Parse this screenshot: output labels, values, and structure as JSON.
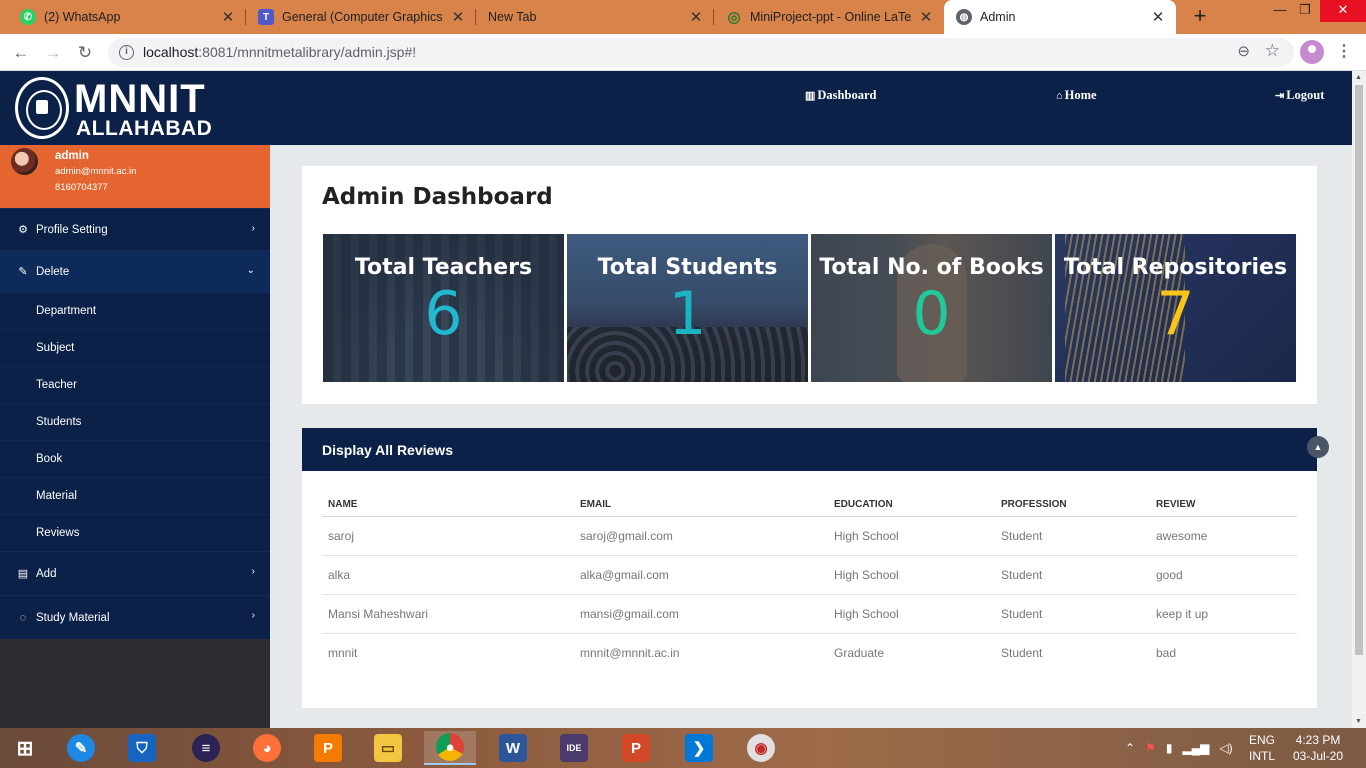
{
  "browser": {
    "tabs": [
      {
        "label": "(2) WhatsApp",
        "icon": "whatsapp-icon",
        "color": "#25d366",
        "glyph": "✆"
      },
      {
        "label": "General (Computer Graphics (CS",
        "icon": "teams-icon",
        "color": "#5059c9",
        "glyph": "T"
      },
      {
        "label": "New Tab",
        "icon": "",
        "color": "",
        "glyph": ""
      },
      {
        "label": "MiniProject-ppt - Online LaTeX",
        "icon": "overleaf-icon",
        "color": "#4f9c45",
        "glyph": "◎"
      },
      {
        "label": "Admin",
        "icon": "globe-icon",
        "color": "#5f6368",
        "glyph": "◍"
      }
    ],
    "url_host": "localhost",
    "url_rest": ":8081/mnnitmetalibrary/admin.jsp#!"
  },
  "header": {
    "logo_line1": "MNNIT",
    "logo_line2": "ALLAHABAD",
    "nav": {
      "dashboard": "Dashboard",
      "home": "Home",
      "logout": "Logout"
    }
  },
  "user": {
    "name": "admin",
    "email": "admin@mnnit.ac.in",
    "phone": "8160704377"
  },
  "sidebar": {
    "profile_setting": "Profile Setting",
    "delete": "Delete",
    "delete_items": [
      "Department",
      "Subject",
      "Teacher",
      "Students",
      "Book",
      "Material",
      "Reviews"
    ],
    "add": "Add",
    "study_material": "Study Material"
  },
  "dashboard": {
    "title": "Admin Dashboard",
    "cards": [
      {
        "label": "Total Teachers",
        "value": "6",
        "value_color": "#22b8cf"
      },
      {
        "label": "Total Students",
        "value": "1",
        "value_color": "#1ab3c2"
      },
      {
        "label": "Total No. of Books",
        "value": "0",
        "value_color": "#20c997"
      },
      {
        "label": "Total Repositories",
        "value": "7",
        "value_color": "#fcc419"
      }
    ]
  },
  "reviews": {
    "title": "Display All Reviews",
    "columns": [
      "NAME",
      "EMAIL",
      "EDUCATION",
      "PROFESSION",
      "REVIEW"
    ],
    "rows": [
      [
        "saroj",
        "saroj@gmail.com",
        "High School",
        "Student",
        "awesome"
      ],
      [
        "alka",
        "alka@gmail.com",
        "High School",
        "Student",
        "good"
      ],
      [
        "Mansi Maheshwari",
        "mansi@gmail.com",
        "High School",
        "Student",
        "keep it up"
      ],
      [
        "mnnit",
        "mnnit@mnnit.ac.in",
        "Graduate",
        "Student",
        "bad"
      ]
    ]
  },
  "taskbar": {
    "lang_line1": "ENG",
    "lang_line2": "INTL",
    "time": "4:23 PM",
    "date": "03-Jul-20"
  }
}
